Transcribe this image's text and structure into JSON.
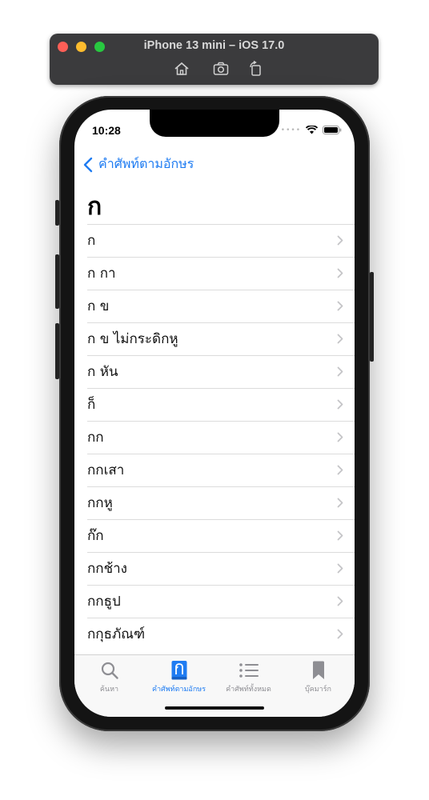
{
  "simulator": {
    "title": "iPhone 13 mini – iOS 17.0",
    "tools": [
      "home-icon",
      "screenshot-icon",
      "rotate-icon"
    ]
  },
  "status_bar": {
    "time": "10:28",
    "icons": [
      "cellular-dots-icon",
      "wifi-icon",
      "battery-icon"
    ]
  },
  "nav": {
    "back_label": "คำศัพท์ตามอักษร"
  },
  "page": {
    "title": "ก"
  },
  "list": {
    "items": [
      "ก",
      "ก กา",
      "ก ข",
      "ก ข ไม่กระดิกหู",
      "ก หัน",
      "ก็",
      "กก",
      "กกเสา",
      "กกหู",
      "ก๊ก",
      "กกช้าง",
      "กกธูป",
      "กกุธภัณฑ์"
    ]
  },
  "tabbar": {
    "tabs": [
      {
        "label": "ค้นหา",
        "icon": "search-icon",
        "active": false
      },
      {
        "label": "คำศัพท์ตามอักษร",
        "icon": "book-icon",
        "active": true
      },
      {
        "label": "คำศัพท์ทั้งหมด",
        "icon": "list-icon",
        "active": false
      },
      {
        "label": "บุ๊คมาร์ก",
        "icon": "bookmark-icon",
        "active": false
      }
    ]
  },
  "colors": {
    "accent": "#1f7cf2",
    "inactive": "#8e8e93",
    "titlebar": "#3b3b3d"
  }
}
